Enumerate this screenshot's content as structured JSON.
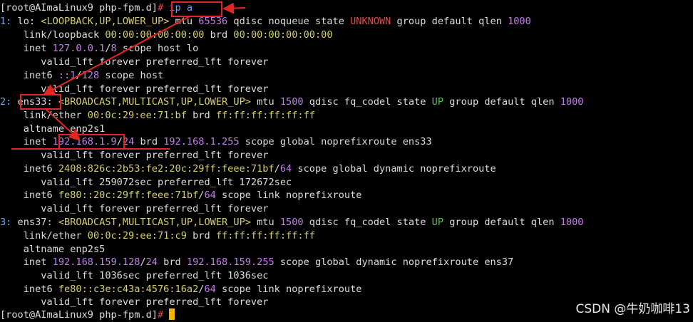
{
  "prompt": {
    "user_host": "[root@AImaLinux9 php-fpm.d]",
    "sym": "#"
  },
  "command": "ip a",
  "lines": {
    "l1": {
      "idx": "1:",
      "name": " lo: ",
      "flags": "<LOOPBACK,UP,LOWER_UP>",
      "mtu_pre": " mtu ",
      "mtu": "65536",
      "rest1": " qdisc noqueue state ",
      "state": "UNKNOWN",
      "rest2": " group default qlen ",
      "qlen": "1000"
    },
    "l2": {
      "pre": "    link/loopback ",
      "mac": "00:00:00:00:00:00",
      "mid": " brd ",
      "brd": "00:00:00:00:00:00"
    },
    "l3": {
      "pre": "    inet ",
      "ip": "127.0.0.1",
      "slash": "/",
      "mask": "8",
      "rest": " scope host lo"
    },
    "l4": {
      "text": "       valid_lft forever preferred_lft forever"
    },
    "l5": {
      "pre": "    inet6 ",
      "ip": "::1",
      "slash": "/",
      "mask": "128",
      "rest": " scope host"
    },
    "l6": {
      "text": "       valid_lft forever preferred_lft forever"
    },
    "l7": {
      "idx": "2:",
      "sp": " ",
      "name": "ens33:",
      "sp2": " ",
      "flags": "<BROADCAST,MULTICAST,UP,LOWER_UP>",
      "mtu_pre": " mtu ",
      "mtu": "1500",
      "rest1": " qdisc fq_codel state ",
      "state": "UP",
      "rest2": " group default qlen ",
      "qlen": "1000"
    },
    "l8": {
      "pre": "    link/ether ",
      "mac": "00:0c:29:ee:71:bf",
      "mid": " brd ",
      "brd": "ff:ff:ff:ff:ff:ff"
    },
    "l9": {
      "text": "    altname enp2s1"
    },
    "l10": {
      "pre": "    inet ",
      "ip": "192.168.1.9",
      "slash": "/",
      "mask": "24",
      "mid": " brd ",
      "brd": "192.168.1.255",
      "rest": " scope global noprefixroute ens33"
    },
    "l11": {
      "text": "       valid_lft forever preferred_lft forever"
    },
    "l12": {
      "pre": "    inet6 ",
      "ip": "2408:826c:2b53:fe2:20c:29ff:feee:71bf",
      "slash": "/",
      "mask": "64",
      "rest": " scope global dynamic noprefixroute"
    },
    "l13": {
      "text": "       valid_lft 259072sec preferred_lft 172672sec"
    },
    "l14": {
      "pre": "    inet6 ",
      "ip": "fe80::20c:29ff:feee:71bf",
      "slash": "/",
      "mask": "64",
      "rest": " scope link noprefixroute"
    },
    "l15": {
      "text": "       valid_lft forever preferred_lft forever"
    },
    "l16": {
      "idx": "3:",
      "name": " ens37: ",
      "flags": "<BROADCAST,MULTICAST,UP,LOWER_UP>",
      "mtu_pre": " mtu ",
      "mtu": "1500",
      "rest1": " qdisc fq_codel state ",
      "state": "UP",
      "rest2": " group default qlen ",
      "qlen": "1000"
    },
    "l17": {
      "pre": "    link/ether ",
      "mac": "00:0c:29:ee:71:c9",
      "mid": " brd ",
      "brd": "ff:ff:ff:ff:ff:ff"
    },
    "l18": {
      "text": "    altname enp2s5"
    },
    "l19": {
      "pre": "    inet ",
      "ip": "192.168.159.128",
      "slash": "/",
      "mask": "24",
      "mid": " brd ",
      "brd": "192.168.159.255",
      "rest": " scope global dynamic noprefixroute ens37"
    },
    "l20": {
      "text": "       valid_lft 1036sec preferred_lft 1036sec"
    },
    "l21": {
      "pre": "    inet6 ",
      "ip": "fe80::c3e:c43a:4576:16a2",
      "slash": "/",
      "mask": "64",
      "rest": " scope link noprefixroute"
    },
    "l22": {
      "text": "       valid_lft forever preferred_lft forever"
    }
  },
  "watermark": "CSDN @牛奶咖啡13",
  "colors": {
    "annotation": "#e52424",
    "cursor": "#f5b400",
    "background": "#000000"
  }
}
